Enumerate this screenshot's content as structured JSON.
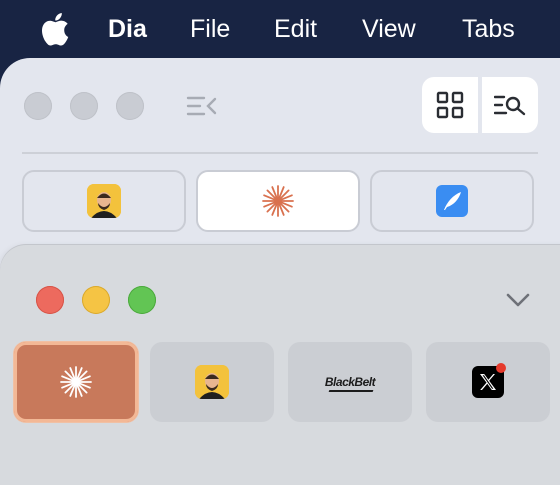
{
  "menubar": {
    "apple_icon": "apple-logo-icon",
    "app_name": "Dia",
    "items": [
      "File",
      "Edit",
      "View",
      "Tabs"
    ]
  },
  "back_window": {
    "toolbar": {
      "sidebar_toggle_icon": "sidebar-collapse-icon",
      "grid_icon": "grid-icon",
      "search_tabs_icon": "list-search-icon"
    },
    "pinned_tabs": [
      {
        "icon": "avatar-icon",
        "active": false
      },
      {
        "icon": "dia-asterisk-icon",
        "active": true
      },
      {
        "icon": "quill-icon",
        "active": false
      }
    ]
  },
  "front_window": {
    "collapse_icon": "chevron-down-icon",
    "tabs": [
      {
        "icon": "dia-asterisk-icon",
        "active": true
      },
      {
        "icon": "avatar-icon",
        "active": false
      },
      {
        "icon": "blackbelt-logo-icon",
        "label": "BlackBelt",
        "active": false
      },
      {
        "icon": "x-logo-icon",
        "active": false
      }
    ]
  },
  "colors": {
    "menubar_bg": "#182443",
    "accent_tab": "#c8795b",
    "asterisk_orange": "#d9714f",
    "traffic_red": "#ed6a5e",
    "traffic_yellow": "#f5c444",
    "traffic_green": "#62c554"
  }
}
